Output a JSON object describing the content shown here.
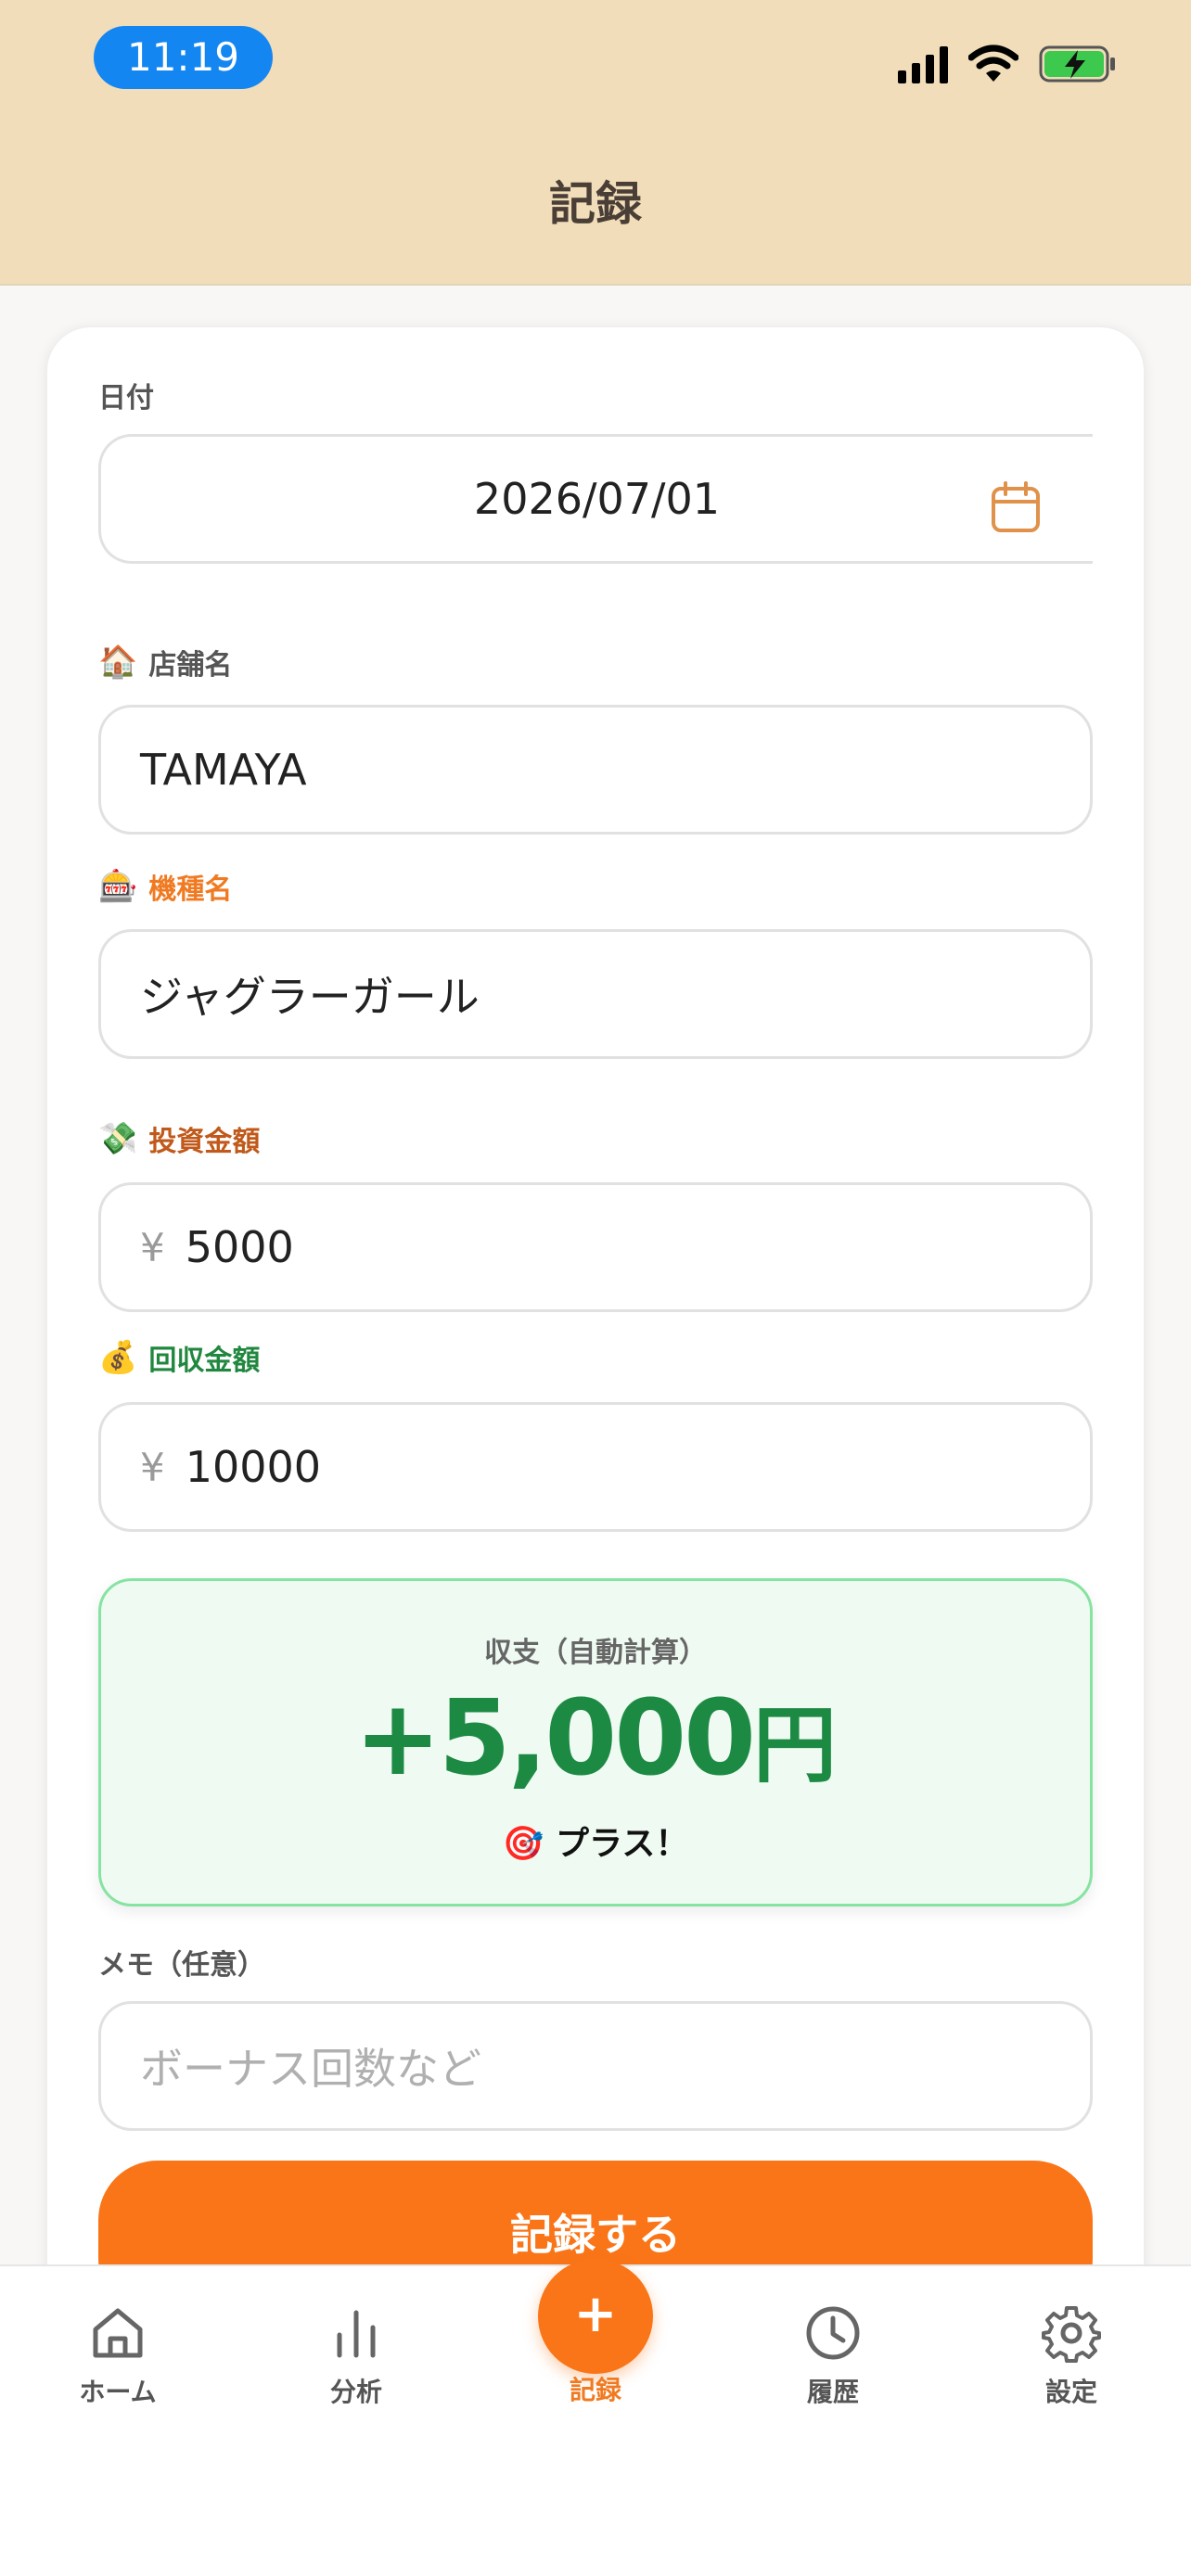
{
  "status_bar": {
    "time": "11:19"
  },
  "header": {
    "title": "記録"
  },
  "form": {
    "date": {
      "label": "日付",
      "value": "2026/07/01"
    },
    "store": {
      "emoji": "🏠",
      "label": "店舗名",
      "value": "TAMAYA"
    },
    "machine": {
      "emoji": "🎰",
      "label": "機種名",
      "value": "ジャグラーガール"
    },
    "investment": {
      "emoji": "💸",
      "label": "投資金額",
      "currency": "¥",
      "value": "5000"
    },
    "recovery": {
      "emoji": "💰",
      "label": "回収金額",
      "currency": "¥",
      "value": "10000"
    },
    "result": {
      "label": "収支（自動計算）",
      "value": "+5,000",
      "unit": "円",
      "note_emoji": "🎯",
      "note": "プラス！"
    },
    "memo": {
      "label": "メモ（任意）",
      "placeholder": "ボーナス回数など"
    },
    "submit_label": "記録する"
  },
  "tabs": {
    "home": "ホーム",
    "analysis": "分析",
    "record": "記録",
    "fab_symbol": "+",
    "history": "履歴",
    "settings": "設定"
  },
  "colors": {
    "accent": "#f97518",
    "header_bg": "#f1ddb9",
    "positive": "#1d8a44",
    "time_pill": "#1486f1"
  }
}
